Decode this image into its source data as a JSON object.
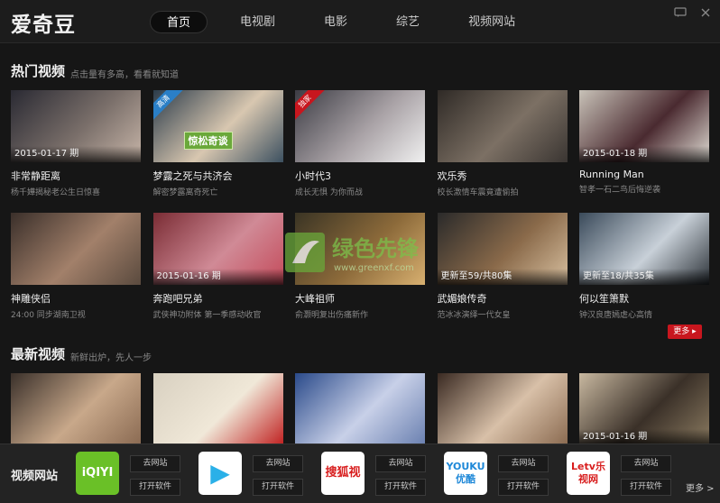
{
  "app": {
    "logo": "爱奇豆"
  },
  "nav": {
    "tabs": [
      "首页",
      "电视剧",
      "电影",
      "综艺",
      "视频网站"
    ],
    "active": 0
  },
  "window": {
    "min_icon": "chat-icon",
    "close_icon": "close-icon"
  },
  "hot": {
    "title": "热门视频",
    "subtitle": "点击量有多高，看看就知道",
    "row1": [
      {
        "title": "非常静距离",
        "desc": "杨千嬅揭秘老公生日惊喜",
        "ep": "2015-01-17 期",
        "ribbon": "",
        "colors": [
          "#2a2a33",
          "#7a6f6a",
          "#c7b5a8"
        ]
      },
      {
        "title": "梦露之死与共济会",
        "desc": "解密梦露离奇死亡",
        "ep": "",
        "ribbon": "高清",
        "ribbon_color": "#2a7fc7",
        "overlay": "惊松奇谈",
        "colors": [
          "#2b3b4a",
          "#d8c7b0",
          "#3c5060"
        ]
      },
      {
        "title": "小时代3",
        "desc": "成长无惧 为你而战",
        "ep": "",
        "ribbon": "独家",
        "ribbon_color": "#c8161e",
        "colors": [
          "#3c3c44",
          "#a9a2a6",
          "#f0f0f0"
        ]
      },
      {
        "title": "欢乐秀",
        "desc": "校长激情车震竟遭偷拍",
        "ep": "",
        "ribbon": "",
        "colors": [
          "#2f2a26",
          "#7c7064",
          "#3a3532"
        ]
      },
      {
        "title": "Running Man",
        "desc": "智孝一石二鸟后悔逆袭",
        "ep": "2015-01-18 期",
        "ribbon": "",
        "colors": [
          "#c8c2b8",
          "#4a2a30",
          "#e2ded6"
        ]
      }
    ],
    "row2": [
      {
        "title": "神雕侠侣",
        "desc": "24:00 同步湖南卫视",
        "ep": "",
        "ribbon": "",
        "colors": [
          "#3a2f2a",
          "#a2806a",
          "#5a4a3e"
        ]
      },
      {
        "title": "奔跑吧兄弟",
        "desc": "武侠神功附体 第一季感动收官",
        "ep": "2015-01-16 期",
        "ribbon": "",
        "colors": [
          "#7a2c34",
          "#d08a96",
          "#c44a5a"
        ]
      },
      {
        "title": "大峰祖师",
        "desc": "俞灏明复出伤痛新作",
        "ep": "",
        "ribbon": "",
        "colors": [
          "#3a3424",
          "#8c6a3a",
          "#d8b070"
        ]
      },
      {
        "title": "武媚娘传奇",
        "desc": "范冰冰演绎一代女皇",
        "ep": "更新至59/共80集",
        "ribbon": "",
        "colors": [
          "#2a2a2a",
          "#8a6a4a",
          "#d8c0a0"
        ]
      },
      {
        "title": "何以笙箫默",
        "desc": "钟汉良唐嫣虐心高情",
        "ep": "更新至18/共35集",
        "ribbon": "",
        "colors": [
          "#3a4a5a",
          "#c8d0d8",
          "#2a3036"
        ]
      }
    ],
    "more": "更多 ▸"
  },
  "latest": {
    "title": "最新视频",
    "subtitle": "新鲜出炉，先人一步",
    "row": [
      {
        "ep": "",
        "colors": [
          "#3a302a",
          "#c8a88a",
          "#8a6a52"
        ]
      },
      {
        "ep": "",
        "colors": [
          "#d8d0c0",
          "#f0e8d8",
          "#c02020"
        ]
      },
      {
        "ep": "",
        "colors": [
          "#2a4a8a",
          "#c8d0e8",
          "#6a80b0"
        ]
      },
      {
        "ep": "",
        "colors": [
          "#3a2a22",
          "#d8c0a8",
          "#8a6a50"
        ]
      },
      {
        "ep": "2015-01-16 期",
        "colors": [
          "#c8b8a0",
          "#3a3028",
          "#8a7a60"
        ]
      }
    ]
  },
  "sites": {
    "label": "视频网站",
    "go": "去网站",
    "open": "打开软件",
    "more": "更多 >",
    "items": [
      {
        "name": "iqiyi-logo",
        "logo_text": "iQIYI",
        "bg": "#6ac027",
        "fg": "#ffffff"
      },
      {
        "name": "tencent-video-logo",
        "logo_text": "▶",
        "bg": "#ffffff",
        "fg": "#2ab0e8"
      },
      {
        "name": "sohu-video-logo",
        "logo_text": "搜狐视频",
        "bg": "#ffffff",
        "fg": "#d81e1e"
      },
      {
        "name": "youku-logo",
        "logo_text": "YOUKU优酷",
        "bg": "#ffffff",
        "fg": "#1e88d8"
      },
      {
        "name": "letv-logo",
        "logo_text": "Letv乐视网",
        "bg": "#ffffff",
        "fg": "#d81e1e"
      }
    ]
  },
  "watermark": {
    "text": "绿色先锋",
    "url": "www.greenxf.com"
  }
}
